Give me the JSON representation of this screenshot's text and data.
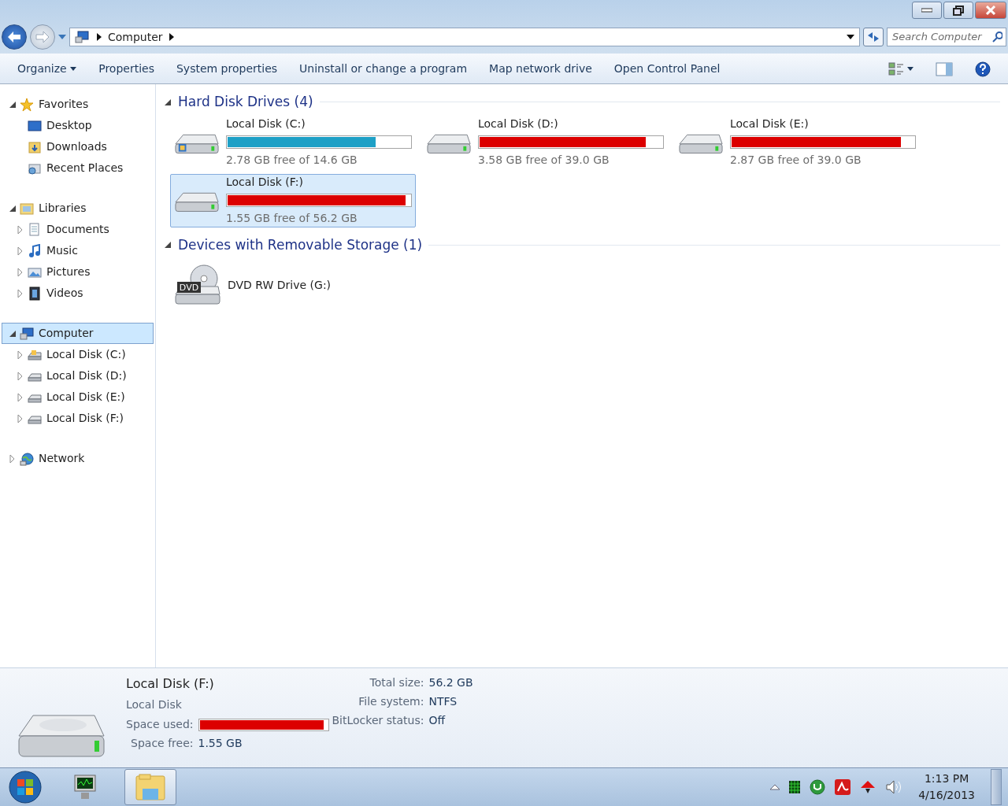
{
  "address": {
    "crumbs": [
      "Computer"
    ]
  },
  "search": {
    "placeholder": "Search Computer"
  },
  "toolbar": {
    "buttons": [
      {
        "label": "Organize",
        "kind": "menu"
      },
      {
        "label": "Properties",
        "kind": "plain"
      },
      {
        "label": "System properties",
        "kind": "plain"
      },
      {
        "label": "Uninstall or change a program",
        "kind": "plain"
      },
      {
        "label": "Map network drive",
        "kind": "plain"
      },
      {
        "label": "Open Control Panel",
        "kind": "plain"
      }
    ]
  },
  "sidebar": {
    "groups": [
      {
        "label": "Favorites",
        "kind": "star",
        "expanded": true,
        "selected": false,
        "children": [
          {
            "label": "Desktop",
            "kind": "desktop",
            "selected": false
          },
          {
            "label": "Downloads",
            "kind": "folder",
            "selected": false
          },
          {
            "label": "Recent Places",
            "kind": "recent",
            "selected": false
          }
        ]
      },
      {
        "label": "Libraries",
        "kind": "library",
        "expanded": true,
        "selected": false,
        "children": [
          {
            "label": "Documents",
            "kind": "doc",
            "expanded": false,
            "selected": false
          },
          {
            "label": "Music",
            "kind": "music",
            "expanded": false,
            "selected": false
          },
          {
            "label": "Pictures",
            "kind": "pictures",
            "expanded": false,
            "selected": false
          },
          {
            "label": "Videos",
            "kind": "video",
            "expanded": false,
            "selected": false
          }
        ]
      },
      {
        "label": "Computer",
        "kind": "computer",
        "expanded": true,
        "selected": true,
        "children": [
          {
            "label": "Local Disk (C:)",
            "kind": "sysdrive",
            "expanded": false,
            "selected": false
          },
          {
            "label": "Local Disk (D:)",
            "kind": "drive",
            "expanded": false,
            "selected": false
          },
          {
            "label": "Local Disk (E:)",
            "kind": "drive",
            "expanded": false,
            "selected": false
          },
          {
            "label": "Local Disk (F:)",
            "kind": "drive",
            "expanded": false,
            "selected": false
          }
        ]
      },
      {
        "label": "Network",
        "kind": "network",
        "expanded": false,
        "selected": false
      }
    ]
  },
  "sections": [
    {
      "title": "Hard Disk Drives (4)",
      "expanded": true,
      "items": [
        {
          "name": "Local Disk (C:)",
          "kind": "sysdisk",
          "level": 0.81,
          "color": "#1ea0c6",
          "free": "2.78 GB free of 14.6 GB",
          "selected": false
        },
        {
          "name": "Local Disk (D:)",
          "kind": "disk",
          "level": 0.908,
          "color": "#dc0000",
          "free": "3.58 GB free of 39.0 GB",
          "selected": false
        },
        {
          "name": "Local Disk (E:)",
          "kind": "disk",
          "level": 0.926,
          "color": "#dc0000",
          "free": "2.87 GB free of 39.0 GB",
          "selected": false
        },
        {
          "name": "Local Disk (F:)",
          "kind": "disk",
          "level": 0.972,
          "color": "#dc0000",
          "free": "1.55 GB free of 56.2 GB",
          "selected": true
        }
      ]
    },
    {
      "title": "Devices with Removable Storage (1)",
      "expanded": true,
      "items": [
        {
          "name": "DVD RW Drive (G:)",
          "kind": "dvd",
          "badge": "DVD",
          "selected": false
        }
      ]
    }
  ],
  "details": {
    "title": "Local Disk (F:)",
    "type": "Local Disk",
    "used_label": "Space used:",
    "level": 0.972,
    "color": "#dc0000",
    "free_label": "Space free:",
    "free_value": "1.55 GB",
    "props": [
      {
        "label": "Total size:",
        "value": "56.2 GB"
      },
      {
        "label": "File system:",
        "value": "NTFS"
      },
      {
        "label": "BitLocker status:",
        "value": "Off"
      }
    ]
  },
  "taskbar": {
    "clock_time": "1:13 PM",
    "clock_date": "4/16/2013"
  }
}
